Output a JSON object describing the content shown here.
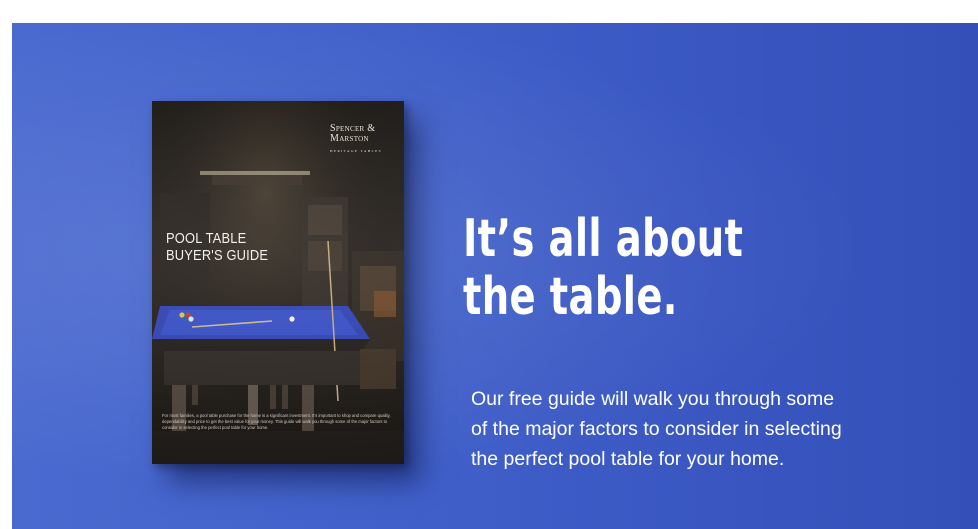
{
  "booklet": {
    "brand_name_line1": "Spencer &",
    "brand_name_line2": "Marston",
    "brand_tagline": "HERITAGE TABLES",
    "title_line1": "POOL TABLE",
    "title_line2": "BUYER'S GUIDE",
    "body_text": "For most families, a pool table purchase for the home is a significant investment. It's important to shop and compare quality, dependability and price to get the best value for your money. This guide will walk you through some of the major factors to consider in selecting the perfect pool table for your home."
  },
  "headline": {
    "line1": "It’s all about",
    "line2": "the table."
  },
  "description": {
    "line1": "Our free guide will walk you through some",
    "line2": "of the major factors to consider in selecting",
    "line3": "the perfect pool table for your home."
  },
  "colors": {
    "banner_blue": "#4262cb",
    "felt_blue": "#2c3fae",
    "text": "#ffffff"
  }
}
